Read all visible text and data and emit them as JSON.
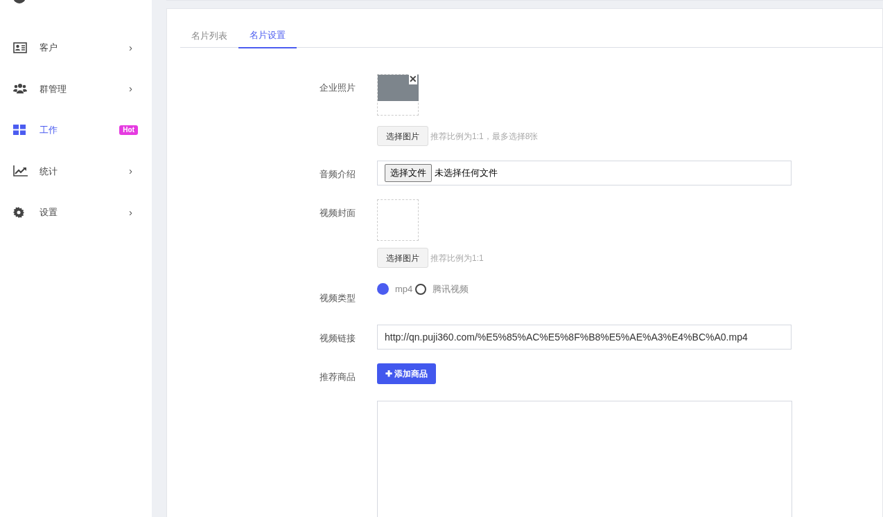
{
  "sidebar": {
    "items": [
      {
        "label": "客户",
        "selected": false,
        "kind": "chevron",
        "symbol": "›"
      },
      {
        "label": "群管理",
        "selected": false,
        "kind": "chevron",
        "symbol": "›"
      },
      {
        "label": "工作",
        "selected": true,
        "kind": "badge",
        "badge": "Hot"
      },
      {
        "label": "统计",
        "selected": false,
        "kind": "chevron",
        "symbol": "›"
      },
      {
        "label": "设置",
        "selected": false,
        "kind": "chevron",
        "symbol": "›"
      }
    ]
  },
  "tabs": [
    {
      "label": "名片列表",
      "selected": false
    },
    {
      "label": "名片设置",
      "selected": true
    }
  ],
  "form": {
    "company_photo": {
      "label": "企业照片",
      "remove": "✕",
      "button": "选择图片",
      "hint": "推荐比例为1:1，最多选择8张"
    },
    "audio_intro": {
      "label": "音频介绍",
      "button": "选择文件",
      "value": "未选择任何文件"
    },
    "video_cover": {
      "label": "视频封面",
      "button": "选择图片",
      "hint": "推荐比例为1:1"
    },
    "video_type": {
      "label": "视频类型",
      "options": [
        {
          "label": "mp4",
          "selected": true
        },
        {
          "label": "腾讯视频",
          "selected": false
        }
      ]
    },
    "video_link": {
      "label": "视频链接",
      "value": "http://qn.puji360.com/%E5%85%AC%E5%8F%B8%E5%AE%A3%E4%BC%A0.mp4"
    },
    "products": {
      "label": "推荐商品",
      "button": "✚ 添加商品"
    }
  }
}
